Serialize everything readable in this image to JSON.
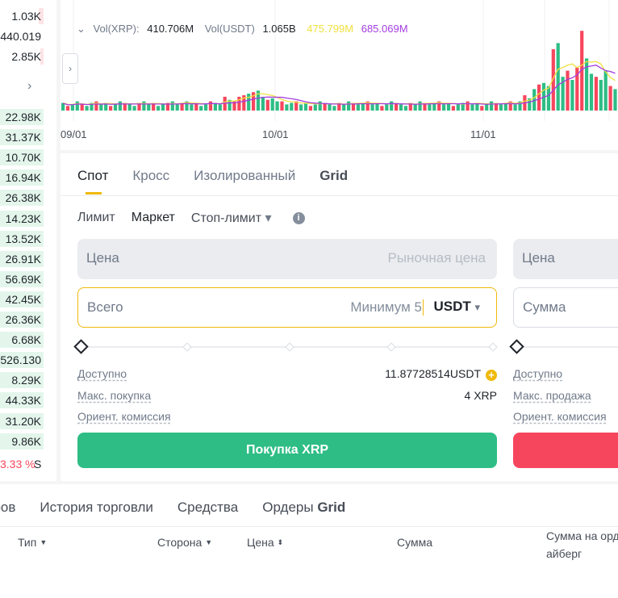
{
  "order_book": {
    "asks": [
      "1.03K",
      "440.019",
      "2.85K"
    ],
    "bids": [
      "22.98K",
      "31.37K",
      "10.70K",
      "16.94K",
      "26.38K",
      "14.23K",
      "13.52K",
      "26.91K",
      "56.69K",
      "42.45K",
      "26.36K",
      "6.68K",
      "526.130",
      "8.29K",
      "44.33K",
      "31.20K",
      "9.86K"
    ],
    "ratio_text": "3.33 %",
    "ratio_suffix": "S"
  },
  "chart": {
    "volume_legend": {
      "vol_xrp_label": "Vol(XRP):",
      "vol_xrp_value": "410.706M",
      "vol_usdt_label": "Vol(USDT)",
      "vol_usdt_value": "1.065B",
      "ma1_value": "475.799M",
      "ma2_value": "685.069M"
    },
    "dates": [
      "09/01",
      "10/01",
      "11/01"
    ],
    "colors": {
      "up": "#2ebd85",
      "down": "#f6465d",
      "ma1": "#f0e040",
      "ma2": "#a43de0"
    }
  },
  "chart_data": {
    "type": "bar",
    "title": "",
    "xlabel": "",
    "ylabel": "",
    "x_ticks": [
      "09/01",
      "10/01",
      "11/01"
    ],
    "series": [
      {
        "name": "Vol(XRP)",
        "values": [
          0.25,
          0.15,
          0.2,
          0.3,
          0.2,
          0.15,
          0.25,
          0.3,
          0.2,
          0.25,
          0.15,
          0.2,
          0.3,
          0.25,
          0.2,
          0.15,
          0.25,
          0.3,
          0.2,
          0.25,
          0.15,
          0.2,
          0.25,
          0.3,
          0.2,
          0.25,
          0.3,
          0.2,
          0.25,
          0.15,
          0.2,
          0.3,
          0.25,
          0.2,
          0.45,
          0.35,
          0.3,
          0.45,
          0.5,
          0.55,
          0.6,
          0.65,
          0.45,
          0.35,
          0.4,
          0.3,
          0.3,
          0.2,
          0.25,
          0.3,
          0.2,
          0.25,
          0.15,
          0.2,
          0.3,
          0.25,
          0.2,
          0.15,
          0.25,
          0.2,
          0.3,
          0.25,
          0.2,
          0.25,
          0.3,
          0.2,
          0.25,
          0.15,
          0.2,
          0.3,
          0.25,
          0.2,
          0.15,
          0.25,
          0.2,
          0.3,
          0.25,
          0.2,
          0.25,
          0.3,
          0.2,
          0.25,
          0.15,
          0.2,
          0.25,
          0.3,
          0.2,
          0.25,
          0.15,
          0.2,
          0.3,
          0.25,
          0.2,
          0.25,
          0.3,
          0.2,
          0.3,
          0.5,
          0.4,
          0.7,
          0.85,
          0.9,
          0.8,
          2.0,
          2.2,
          1.1,
          1.3,
          1.0,
          1.4,
          2.6,
          1.7,
          1.2,
          1.1,
          1.0,
          1.3,
          0.8,
          0.7
        ]
      }
    ]
  },
  "panel": {
    "tabs": [
      "Спот",
      "Кросс",
      "Изолированный",
      "Grid"
    ],
    "order_types": {
      "limit": "Лимит",
      "market": "Маркет",
      "stop": "Стоп-лимит"
    },
    "buy": {
      "price_label": "Цена",
      "price_placeholder": "Рыночная цена",
      "total_label": "Всего",
      "total_placeholder": "Минимум 5",
      "currency": "USDT",
      "slider_percent": 0,
      "available_label": "Доступно",
      "available_value": "11.87728514USDT",
      "max_label": "Макс. покупка",
      "max_value": "4 XRP",
      "fee_label": "Ориент. комиссия",
      "button": "Покупка XRP"
    },
    "sell": {
      "price_label": "Цена",
      "amount_label": "Сумма",
      "slider_percent": 0,
      "available_label": "Доступно",
      "max_label": "Макс. продажа",
      "fee_label": "Ориент. комиссия"
    }
  },
  "bottom": {
    "tabs": [
      "еров",
      "История торговли",
      "Средства"
    ],
    "grid_tab_prefix": "Ордеры",
    "grid_tab_suffix": "Grid",
    "headers": {
      "type": "Тип",
      "side": "Сторона",
      "price": "Цена",
      "amount": "Сумма",
      "iceberg_1": "Сумма на орд",
      "iceberg_2": "айберг"
    }
  }
}
